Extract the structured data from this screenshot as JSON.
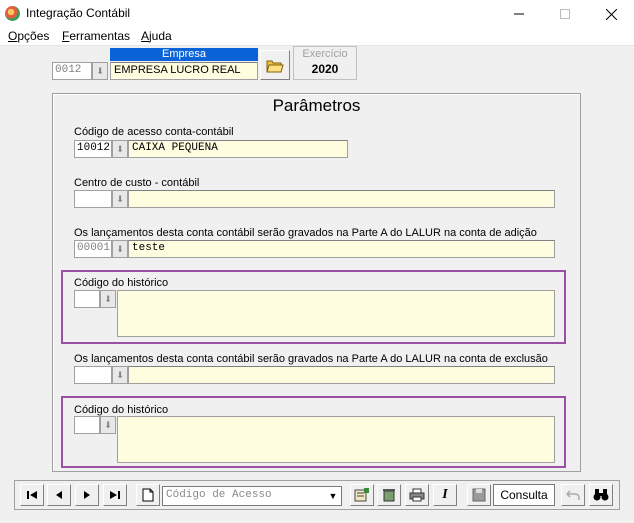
{
  "window": {
    "title": "Integração Contábil"
  },
  "menu": [
    {
      "label": "Opções"
    },
    {
      "label": "Ferramentas"
    },
    {
      "label": "Ajuda"
    }
  ],
  "empresa": {
    "header": "Empresa",
    "code": "0012",
    "name": "EMPRESA LUCRO REAL"
  },
  "exercicio": {
    "label": "Exercício",
    "year": "2020"
  },
  "params": {
    "title": "Parâmetros",
    "conta": {
      "label": "Código de acesso conta-contábil",
      "code": "10012",
      "name": "CAIXA PEQUENA"
    },
    "centro": {
      "label": "Centro de custo - contábil",
      "code": "",
      "name": ""
    },
    "adicao": {
      "label": "Os lançamentos desta conta contábil serão gravados na Parte A do LALUR na conta de adição",
      "code": "00001",
      "name": "teste"
    },
    "hist1": {
      "label": "Código do histórico",
      "code": "",
      "text": ""
    },
    "exclusao": {
      "label": "Os lançamentos desta conta contábil serão gravados na Parte A do LALUR na conta de exclusão",
      "code": "",
      "name": ""
    },
    "hist2": {
      "label": "Código do histórico",
      "code": "",
      "text": ""
    }
  },
  "toolbar": {
    "combo_placeholder": "Código de Acesso",
    "consulta_label": "Consulta"
  },
  "colors": {
    "accent": "#0a64d8",
    "highlight_border": "#9b4fa5",
    "field_bg": "#fffde0"
  }
}
